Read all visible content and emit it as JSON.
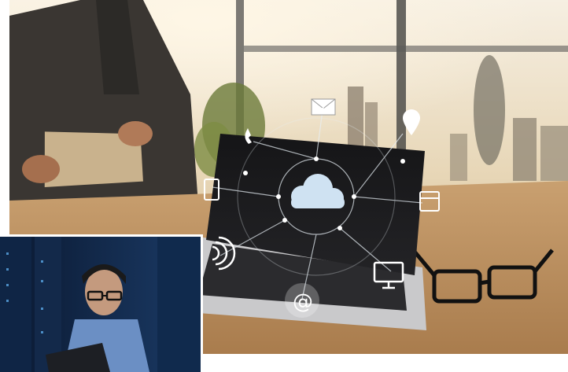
{
  "scene": {
    "main_photo": {
      "subject": "laptop-with-cloud-network-icons",
      "icons": [
        "cloud-icon",
        "mail-icon",
        "phone-icon",
        "location-pin-icon",
        "tablet-icon",
        "calendar-icon",
        "wifi-signal-icon",
        "at-sign-icon",
        "monitor-icon"
      ],
      "colors": {
        "window_light": "#f2e6cf",
        "desk": "#b98a55",
        "laptop_dark": "#1c1c1e",
        "cloud": "#cfe2f2",
        "network": "#e8f0f6"
      }
    },
    "inset_photo": {
      "subject": "engineer-in-server-room",
      "colors": {
        "bg": "#0d2242",
        "rack": "#13294a",
        "rack_light": "#5aa7e6",
        "shirt": "#6b8fc4"
      }
    }
  }
}
